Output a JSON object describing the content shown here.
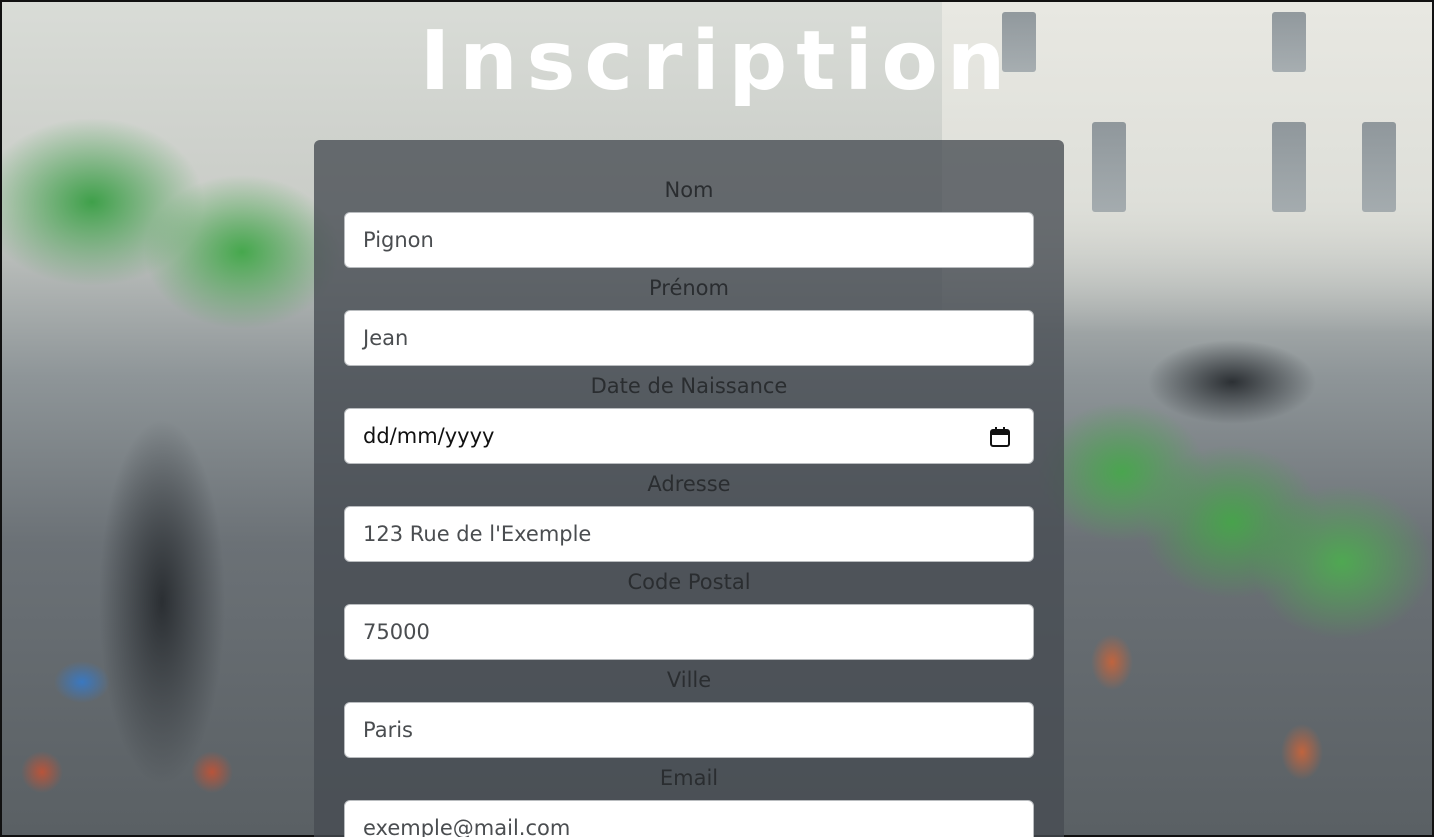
{
  "page": {
    "title": "Inscription"
  },
  "form": {
    "fields": [
      {
        "label": "Nom",
        "value": "Pignon"
      },
      {
        "label": "Prénom",
        "value": "Jean"
      },
      {
        "label": "Date de Naissance",
        "value": "dd/mm/yyyy"
      },
      {
        "label": "Adresse",
        "value": "123 Rue de l'Exemple"
      },
      {
        "label": "Code Postal",
        "value": "75000"
      },
      {
        "label": "Ville",
        "value": "Paris"
      },
      {
        "label": "Email",
        "value": "exemple@mail.com"
      }
    ]
  },
  "colors": {
    "card": "#464b52",
    "title": "#ffffff",
    "input_bg": "#ffffff"
  },
  "icons": {
    "date_picker": "calendar-icon"
  }
}
